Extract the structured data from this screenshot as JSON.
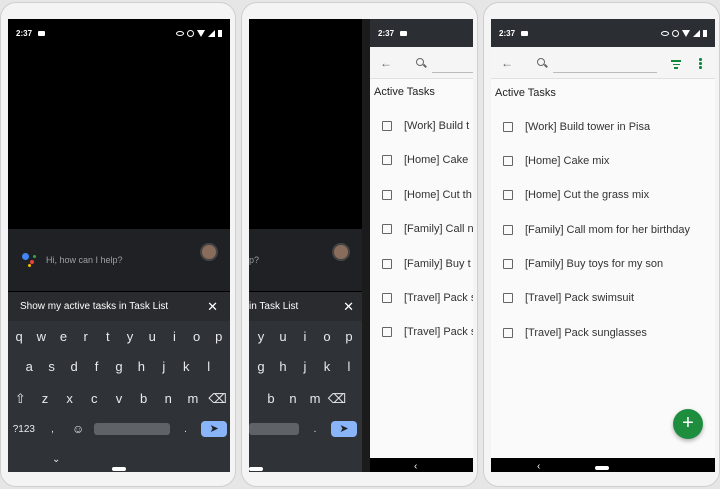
{
  "status_time": "2:37",
  "assistant": {
    "greeting": "Hi, how can I help?",
    "greeting_partial": "p?",
    "query": "Show my active tasks in Task List",
    "query_partial": "in Task List",
    "close_glyph": "✕"
  },
  "keyboard": {
    "row1": [
      "q",
      "w",
      "e",
      "r",
      "t",
      "y",
      "u",
      "i",
      "o",
      "p"
    ],
    "row2": [
      "a",
      "s",
      "d",
      "f",
      "g",
      "h",
      "j",
      "k",
      "l"
    ],
    "row3": [
      "z",
      "x",
      "c",
      "v",
      "b",
      "n",
      "m"
    ],
    "shift_glyph": "⇧",
    "backspace_glyph": "⌫",
    "symbols_label": "?123",
    "comma_label": ",",
    "emoji_glyph": "☺",
    "period_label": ".",
    "enter_glyph": "➤",
    "collapse_glyph": "⌄",
    "partial_row1": [
      "y",
      "u",
      "i",
      "o",
      "p"
    ],
    "partial_row2": [
      "g",
      "h",
      "j",
      "k",
      "l"
    ],
    "partial_row3": [
      "b",
      "n",
      "m"
    ]
  },
  "app": {
    "back_glyph": "←",
    "section_title": "Active Tasks",
    "tasks": [
      "[Work] Build tower in Pisa",
      "[Home] Cake mix",
      "[Home] Cut the grass mix",
      "[Family] Call mom for her birthday",
      "[Family] Buy toys for my son",
      "[Travel] Pack swimsuit",
      "[Travel] Pack sunglasses"
    ],
    "tasks_partial": [
      "[Work] Build t",
      "[Home] Cake",
      "[Home] Cut th",
      "[Family] Call n",
      "[Family] Buy t",
      "[Travel] Pack s",
      "[Travel] Pack s"
    ],
    "nav_back_glyph": "‹",
    "fab_label": "+"
  },
  "colors": {
    "accent": "#1e8e3e",
    "enter_key": "#8ab4f8"
  }
}
